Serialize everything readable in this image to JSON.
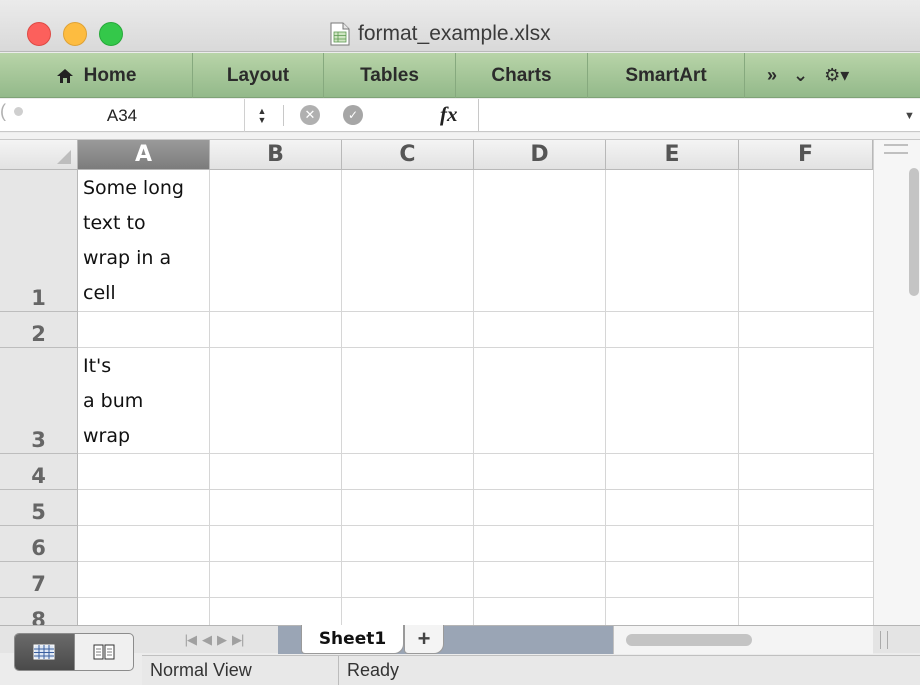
{
  "window": {
    "title": "format_example.xlsx"
  },
  "ribbon": {
    "tabs": [
      {
        "label": "Home"
      },
      {
        "label": "Layout"
      },
      {
        "label": "Tables"
      },
      {
        "label": "Charts"
      },
      {
        "label": "SmartArt"
      }
    ],
    "overflow": "»",
    "collapse": "⌄",
    "settings": "⚙▾"
  },
  "formula_bar": {
    "name_box": "A34",
    "fx_label": "fx",
    "formula_value": ""
  },
  "grid": {
    "columns": [
      "A",
      "B",
      "C",
      "D",
      "E",
      "F"
    ],
    "selected_column": "A",
    "rows": [
      "1",
      "2",
      "3",
      "4",
      "5",
      "6",
      "7",
      "8"
    ],
    "cells": {
      "A1": [
        "Some long",
        "text to",
        "wrap in a",
        "cell"
      ],
      "A3": [
        "It's",
        "a bum",
        "wrap"
      ]
    }
  },
  "sheets": {
    "tabs": [
      {
        "label": "Sheet1",
        "active": true
      }
    ],
    "add_label": "+"
  },
  "status": {
    "view_mode": "Normal View",
    "state": "Ready"
  },
  "colors": {
    "ribbon": "#a5c798",
    "selected_header": "#8a8a8a",
    "sheet_tab_area": "#9aa5b5"
  }
}
